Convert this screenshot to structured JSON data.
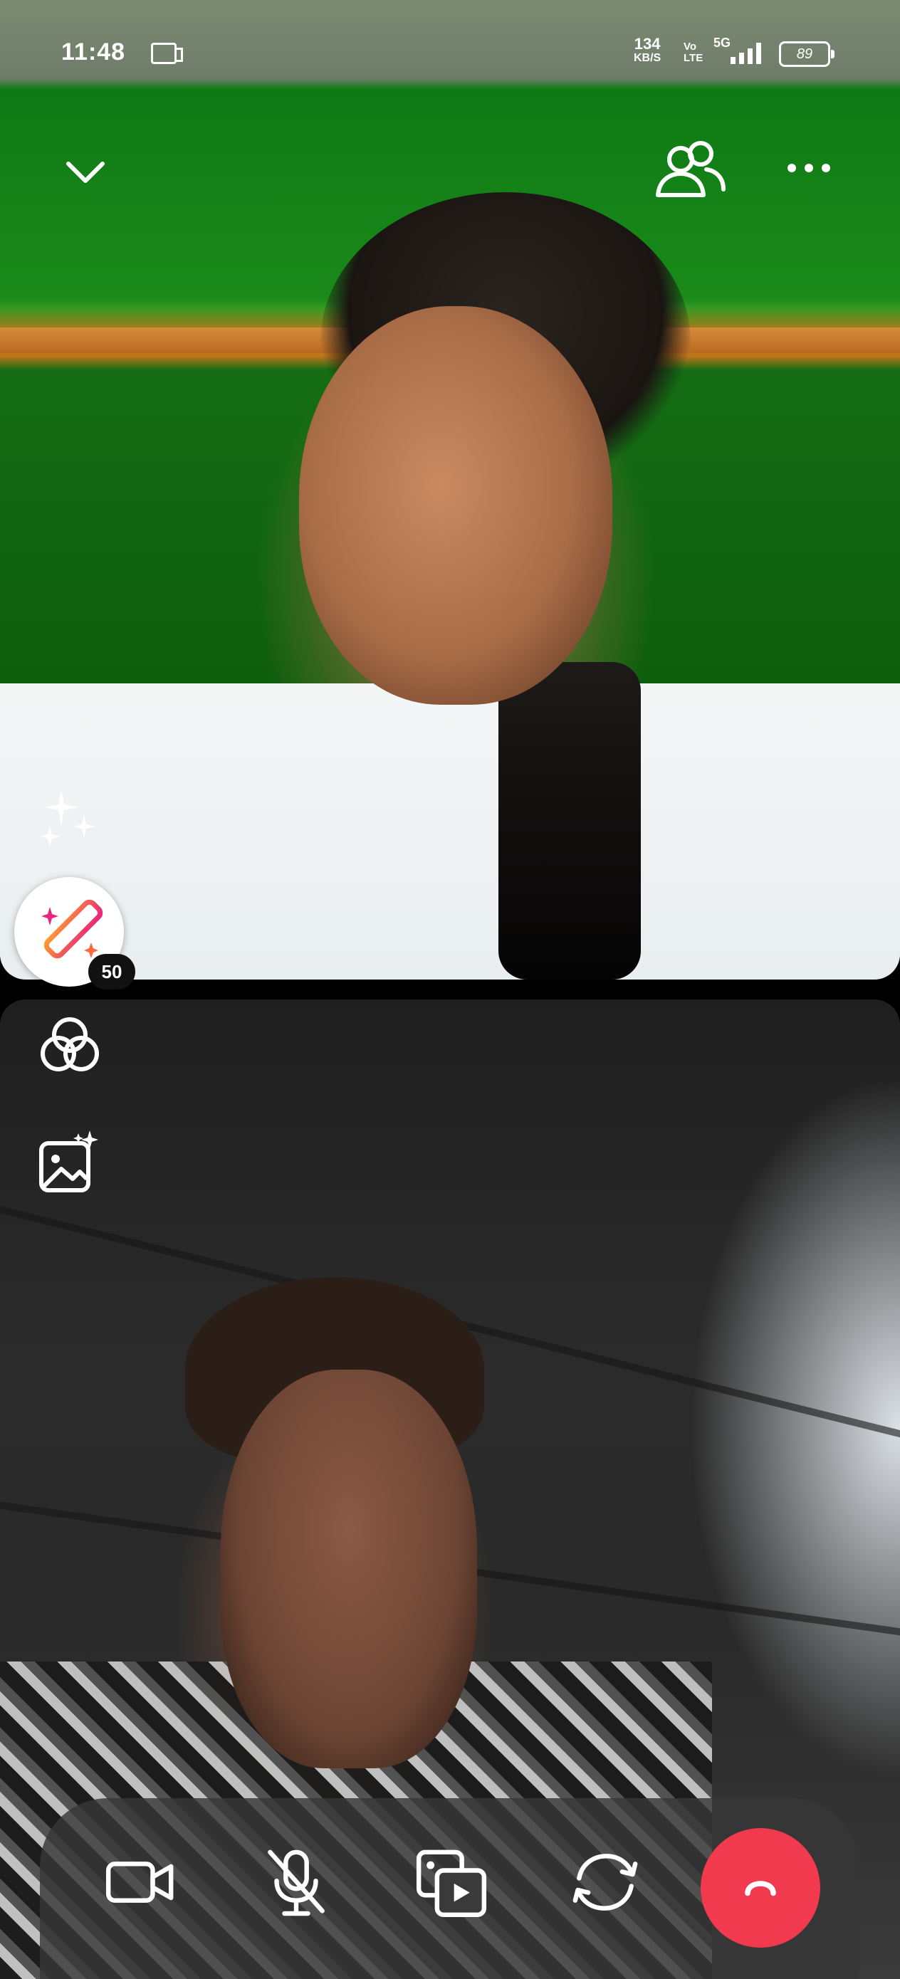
{
  "status_bar": {
    "time": "11:48",
    "net_speed_value": "134",
    "net_speed_unit": "KB/S",
    "volte": "Vo\nLTE",
    "network": "5G",
    "battery": "89"
  },
  "top_controls": {
    "collapse_icon": "chevron-down-icon",
    "participants_icon": "people-icon",
    "more_icon": "more-horizontal-icon"
  },
  "effects": {
    "effect_count": "50"
  },
  "call_controls": {
    "camera_icon": "video-camera-icon",
    "mic_icon": "mic-muted-icon",
    "share_icon": "media-share-icon",
    "flip_icon": "flip-camera-icon",
    "end_icon": "end-call-icon",
    "end_color": "#f23a4e"
  }
}
